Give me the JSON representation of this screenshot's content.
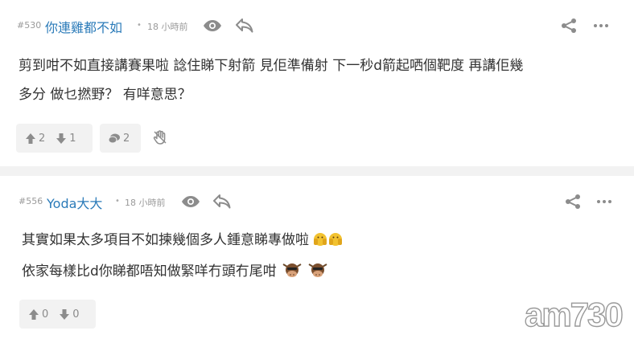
{
  "comments": [
    {
      "number": "#530",
      "author": "你連雞都不如",
      "separator": "•",
      "time": "18 小時前",
      "lines": [
        "剪到咁不如直接講賽果啦 諗住睇下射箭 見佢準備射 下一秒d箭起哂個靶度 再講佢幾",
        "多分 做乜撚野？ 有咩意思？"
      ],
      "upvotes": "2",
      "downvotes": "1",
      "replies": "2"
    },
    {
      "number": "#556",
      "author": "Yoda大大",
      "separator": "•",
      "time": "18 小時前",
      "lines": [
        "其實如果太多項目不如揀幾個多人鍾意睇專做啦",
        "依家每樣比d你睇都唔知做緊咩冇頭冇尾咁"
      ],
      "upvotes": "0",
      "downvotes": "0"
    }
  ],
  "icons": {
    "view": "eye-icon",
    "reply": "reply-arrow-icon",
    "share": "share-icon",
    "more": "more-dots-icon",
    "upvote": "thumbs-up-icon",
    "downvote": "thumbs-down-icon",
    "replies": "chat-bubble-icon",
    "report": "hand-icon",
    "emoji_face": "hands-over-face-emoji-icon",
    "emoji_cow": "cow-head-emoji-icon"
  },
  "watermark": {
    "text": "am730"
  },
  "colors": {
    "author": "#2b7bb9",
    "muted": "#9a9a9a",
    "icon": "#8c8c8c",
    "button_bg": "#f2f2f2",
    "divider": "#f2f2f2"
  }
}
